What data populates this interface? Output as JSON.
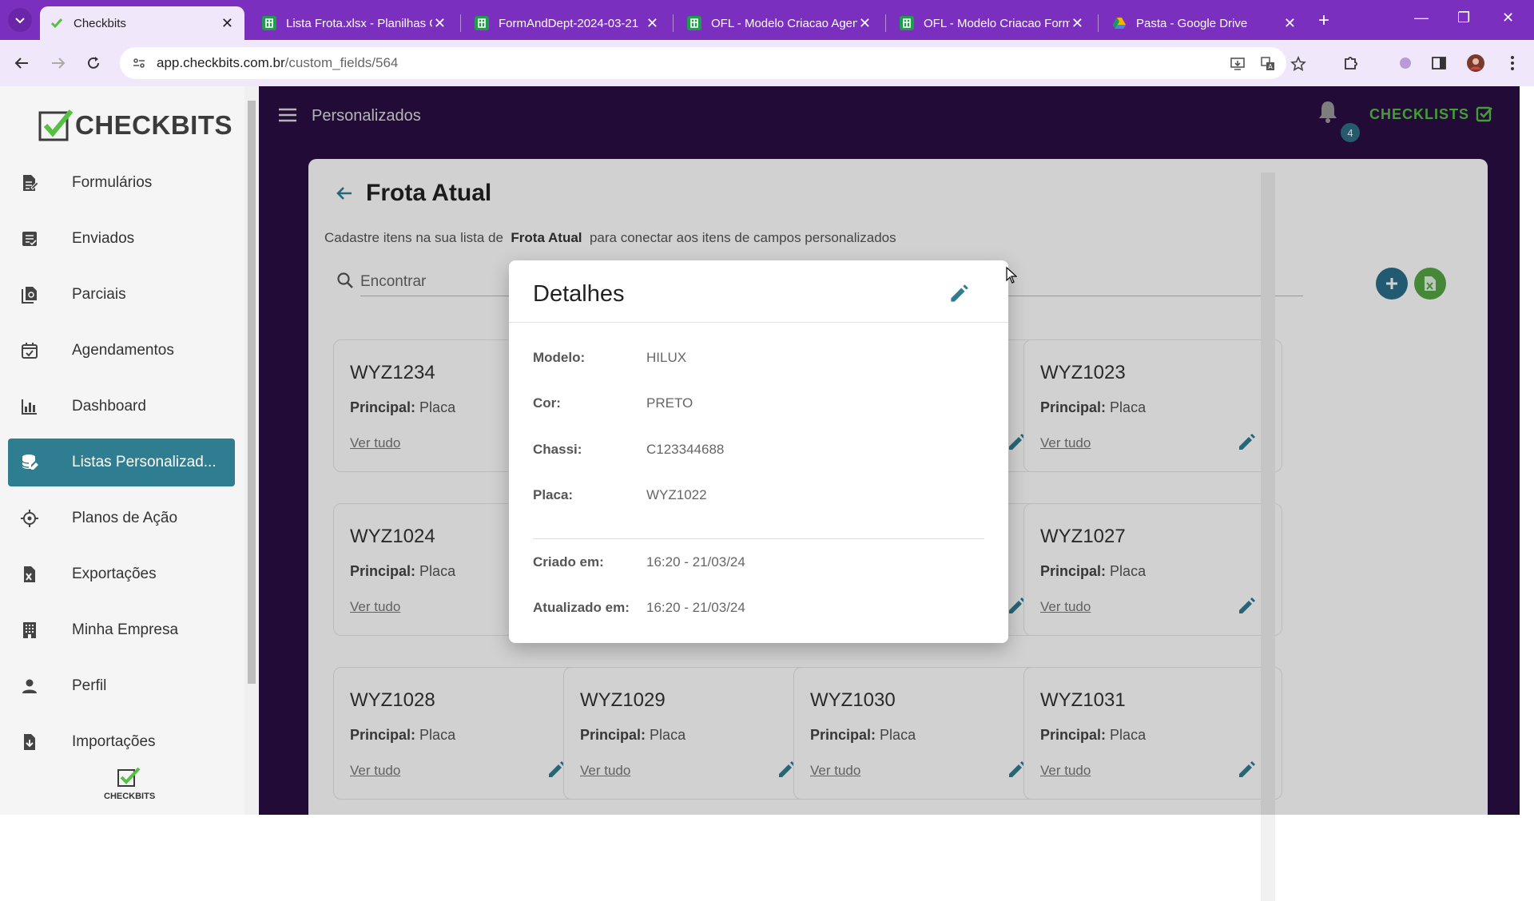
{
  "browser": {
    "tabs": [
      {
        "title": "Checkbits",
        "icon": "checkbits-favicon",
        "active": true
      },
      {
        "title": "Lista Frota.xlsx - Planilhas G",
        "icon": "sheets-icon"
      },
      {
        "title": "FormAndDept-2024-03-21",
        "icon": "sheets-icon"
      },
      {
        "title": "OFL - Modelo Criacao Agen",
        "icon": "sheets-icon"
      },
      {
        "title": "OFL - Modelo Criacao Form",
        "icon": "sheets-icon"
      },
      {
        "title": "Pasta - Google Drive",
        "icon": "drive-icon"
      }
    ],
    "url_host": "app.checkbits.com.br",
    "url_path": "/custom_fields/564"
  },
  "sidebar": {
    "logo_text": "CHECKBITS",
    "items": [
      {
        "label": "Formulários",
        "icon": "forms-icon"
      },
      {
        "label": "Enviados",
        "icon": "sent-icon"
      },
      {
        "label": "Parciais",
        "icon": "partial-icon"
      },
      {
        "label": "Agendamentos",
        "icon": "calendar-icon"
      },
      {
        "label": "Dashboard",
        "icon": "chart-icon"
      },
      {
        "label": "Listas Personalizad...",
        "icon": "database-icon",
        "active": true
      },
      {
        "label": "Planos de Ação",
        "icon": "crosshair-icon"
      },
      {
        "label": "Exportações",
        "icon": "excel-file-icon"
      },
      {
        "label": "Minha Empresa",
        "icon": "building-icon"
      },
      {
        "label": "Perfil",
        "icon": "person-icon"
      },
      {
        "label": "Importações",
        "icon": "import-file-icon"
      }
    ],
    "bottom_logo_text": "CHECKBITS"
  },
  "header": {
    "title": "Personalizados",
    "notification_count": "4",
    "checklists_label": "CHECKLISTS"
  },
  "page": {
    "title": "Frota Atual",
    "desc_before": "Cadastre itens na sua lista de",
    "desc_bold": "Frota Atual",
    "desc_after": "para conectar aos itens de campos personalizados",
    "search_placeholder": "Encontrar"
  },
  "cards": [
    {
      "title": "WYZ1234",
      "principal_label": "Principal:",
      "principal_value": "Placa",
      "link": "Ver tudo"
    },
    {
      "title": "WYZ1023",
      "principal_label": "Principal:",
      "principal_value": "Placa",
      "link": "Ver tudo"
    },
    {
      "title": "WYZ1024",
      "principal_label": "Principal:",
      "principal_value": "Placa",
      "link": "Ver tudo"
    },
    {
      "title": "WYZ1027",
      "principal_label": "Principal:",
      "principal_value": "Placa",
      "link": "Ver tudo"
    },
    {
      "title": "WYZ1028",
      "principal_label": "Principal:",
      "principal_value": "Placa",
      "link": "Ver tudo"
    },
    {
      "title": "WYZ1029",
      "principal_label": "Principal:",
      "principal_value": "Placa",
      "link": "Ver tudo"
    },
    {
      "title": "WYZ1030",
      "principal_label": "Principal:",
      "principal_value": "Placa",
      "link": "Ver tudo"
    },
    {
      "title": "WYZ1031",
      "principal_label": "Principal:",
      "principal_value": "Placa",
      "link": "Ver tudo"
    }
  ],
  "partial_cards": [
    {
      "link": "a"
    },
    {
      "link": "a"
    }
  ],
  "modal": {
    "title": "Detalhes",
    "fields": [
      {
        "label": "Modelo:",
        "value": "HILUX"
      },
      {
        "label": "Cor:",
        "value": "PRETO"
      },
      {
        "label": "Chassi:",
        "value": "C123344688"
      },
      {
        "label": "Placa:",
        "value": "WYZ1022"
      }
    ],
    "meta": [
      {
        "label": "Criado em:",
        "value": "16:20 - 21/03/24"
      },
      {
        "label": "Atualizado em:",
        "value": "16:20 - 21/03/24"
      }
    ]
  },
  "colors": {
    "brand_purple": "#7b2fbe",
    "main_bg": "#2a0f44",
    "accent_teal": "#2f7d91",
    "checklists_green": "#55c042",
    "fab_blue": "#2a6f8a",
    "fab_green": "#55a845"
  }
}
